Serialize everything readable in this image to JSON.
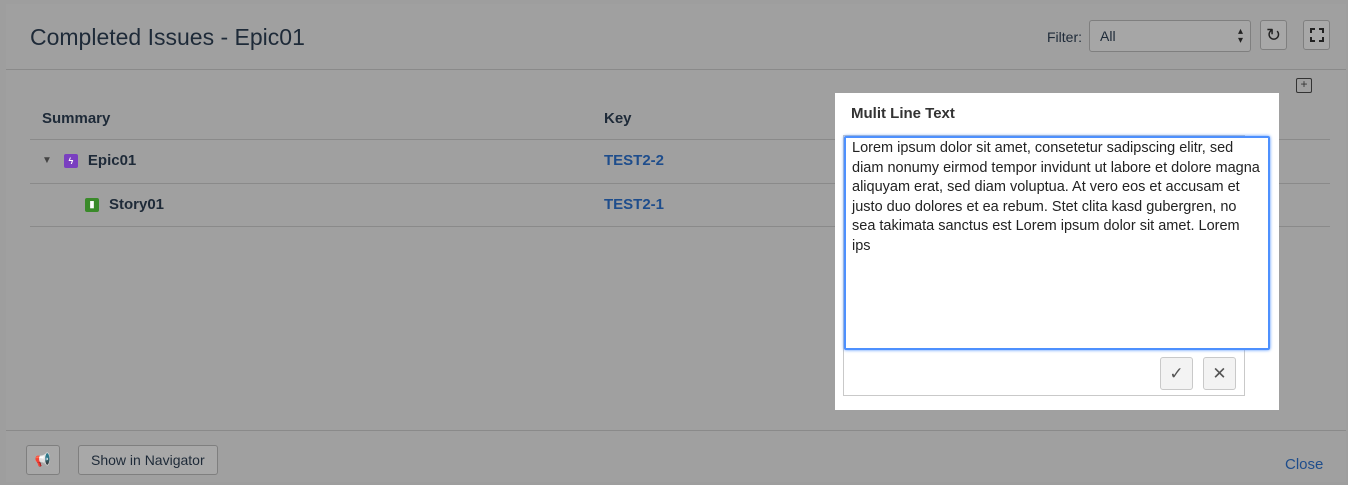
{
  "header": {
    "title": "Completed Issues - Epic01",
    "filter_label": "Filter:",
    "filter_value": "All",
    "refresh_icon": "refresh-icon",
    "fullscreen_icon": "fullscreen-icon"
  },
  "table": {
    "columns": [
      "Summary",
      "Key"
    ],
    "rows": [
      {
        "summary": "Epic01",
        "key": "TEST2-2",
        "type": "epic",
        "expanded": true
      },
      {
        "summary": "Story01",
        "key": "TEST2-1",
        "type": "story"
      }
    ]
  },
  "editor": {
    "title": "Mulit Line Text",
    "text": "Lorem ipsum dolor sit amet, consetetur sadipscing elitr, sed diam nonumy eirmod tempor invidunt ut labore et dolore magna aliquyam erat, sed diam voluptua. At vero eos et accusam et justo duo dolores et ea rebum. Stet clita kasd gubergren, no sea takimata sanctus est Lorem ipsum dolor sit amet. Lorem ips",
    "confirm_symbol": "✓",
    "cancel_symbol": "✕"
  },
  "footer": {
    "navigator_label": "Show in Navigator",
    "close_label": "Close"
  },
  "colors": {
    "accent_link": "#1e4d8c",
    "editor_focus": "#4d90fe",
    "epic": "#7a3fc0",
    "story": "#3a8a2a"
  }
}
